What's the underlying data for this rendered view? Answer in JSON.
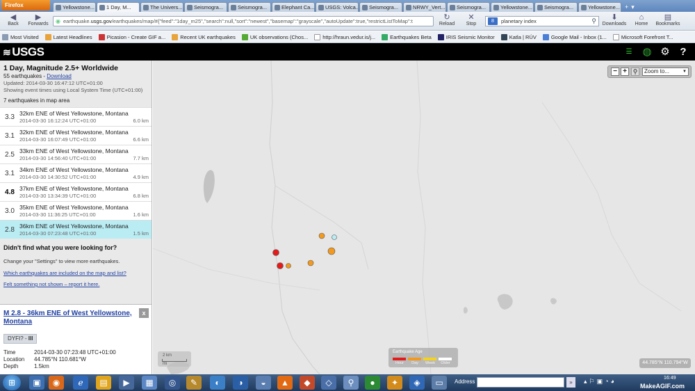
{
  "browser": {
    "app_button": "Firefox",
    "tabs": [
      {
        "label": "Yellowstone...",
        "active": false
      },
      {
        "label": "1 Day, M...",
        "active": true
      },
      {
        "label": "The Univers...",
        "active": false
      },
      {
        "label": "Seismogra...",
        "active": false
      },
      {
        "label": "Seismogra...",
        "active": false
      },
      {
        "label": "Elephant Ca...",
        "active": false
      },
      {
        "label": "USGS: Volca...",
        "active": false
      },
      {
        "label": "Seismogra...",
        "active": false
      },
      {
        "label": "NRWY_Vert...",
        "active": false
      },
      {
        "label": "Seismogra...",
        "active": false
      },
      {
        "label": "Yellowstone...",
        "active": false
      },
      {
        "label": "Seismogra...",
        "active": false
      },
      {
        "label": "Yellowstone...",
        "active": false
      }
    ],
    "nav": {
      "back": "Back",
      "forwards": "Forwards",
      "reload": "Reload",
      "stop": "Stop",
      "downloads": "Downloads",
      "home": "Home",
      "bookmarks": "Bookmarks"
    },
    "url_prefix": "earthquake.",
    "url_domain": "usgs.gov",
    "url_path": "/earthquakes/map/#{\"feed\":\"1day_m25\",\"search\":null,\"sort\":\"newest\",\"basemap\":\"grayscale\",\"autoUpdate\":true,\"restrictListToMap\":t",
    "search_value": "planetary index",
    "bookmarks": [
      "Most Visited",
      "Latest Headlines",
      "Picasion - Create GIF a...",
      "Recent UK earthquakes",
      "UK observations (Chos...",
      "http://hraun.vedur.is/j...",
      "Earthquakes Beta",
      "IRIS Seismic Monitor",
      "Katla | RÚV",
      "Google Mail - Inbox (1...",
      "Microsoft Forefront T..."
    ]
  },
  "usgs": {
    "logo_text": "USGS"
  },
  "sidebar": {
    "title": "1 Day, Magnitude 2.5+ Worldwide",
    "count_text": "55 earthquakes - ",
    "download_link": "Download",
    "updated": "Updated: 2014-03-30 16:47:12 UTC+01:00",
    "time_note": "Showing event times using Local System Time (UTC+01:00)",
    "in_area": "7 earthquakes in map area",
    "earthquakes": [
      {
        "mag": "3.3",
        "place": "32km ENE of West Yellowstone, Montana",
        "time": "2014-03-30 16:12:24 UTC+01:00",
        "depth": "6.0 km",
        "big": false,
        "selected": false
      },
      {
        "mag": "3.1",
        "place": "32km ENE of West Yellowstone, Montana",
        "time": "2014-03-30 16:07:49 UTC+01:00",
        "depth": "6.6 km",
        "big": false,
        "selected": false
      },
      {
        "mag": "2.5",
        "place": "33km ENE of West Yellowstone, Montana",
        "time": "2014-03-30 14:56:40 UTC+01:00",
        "depth": "7.7 km",
        "big": false,
        "selected": false
      },
      {
        "mag": "3.1",
        "place": "34km ENE of West Yellowstone, Montana",
        "time": "2014-03-30 14:30:52 UTC+01:00",
        "depth": "4.9 km",
        "big": false,
        "selected": false
      },
      {
        "mag": "4.8",
        "place": "37km ENE of West Yellowstone, Montana",
        "time": "2014-03-30 13:34:39 UTC+01:00",
        "depth": "6.8 km",
        "big": true,
        "selected": false
      },
      {
        "mag": "3.0",
        "place": "35km ENE of West Yellowstone, Montana",
        "time": "2014-03-30 11:36:25 UTC+01:00",
        "depth": "1.6 km",
        "big": false,
        "selected": false
      },
      {
        "mag": "2.8",
        "place": "36km ENE of West Yellowstone, Montana",
        "time": "2014-03-30 07:23:48 UTC+01:00",
        "depth": "1.5 km",
        "big": false,
        "selected": true
      }
    ],
    "help_title": "Didn't find what you were looking for?",
    "help_settings": "Change your \"Settings\" to view more earthquakes.",
    "help_which": "Which earthquakes are included on the map and list?",
    "help_report": "Felt something not shown – report it here."
  },
  "detail": {
    "title": "M 2.8 - 36km ENE of West Yellowstone, Montana",
    "close": "x",
    "dyfi_label": "DYFI? - ",
    "dyfi_value": "III",
    "time_label": "Time",
    "time_value": "2014-03-30 07:23:48 UTC+01:00",
    "location_label": "Location",
    "location_value": "44.785°N 110.681°W",
    "depth_label": "Depth",
    "depth_value": "1.5km"
  },
  "map": {
    "zoom_label": "Zoom to...",
    "scale_top": "2 km",
    "scale_bottom": "mi",
    "legend_title": "Earthquake Age",
    "legend_items": [
      {
        "label": "Hour",
        "color": "#e31b1b"
      },
      {
        "label": "Day",
        "color": "#f39a1e"
      },
      {
        "label": "Week",
        "color": "#f5d31c"
      },
      {
        "label": "Older",
        "color": "#ffffff"
      }
    ],
    "coords": "44.785°N 110.794°W",
    "markers": [
      {
        "name": "eq-marker-hour-1",
        "color": "#e31b1b"
      },
      {
        "name": "eq-marker-hour-2",
        "color": "#e31b1b"
      },
      {
        "name": "eq-marker-day-1",
        "color": "#f39a1e"
      },
      {
        "name": "eq-marker-day-2",
        "color": "#f39a1e"
      },
      {
        "name": "eq-marker-day-3",
        "color": "#f39a1e"
      },
      {
        "name": "eq-marker-day-4",
        "color": "#f39a1e"
      },
      {
        "name": "eq-marker-selected",
        "color": "#b9ecf3"
      }
    ]
  },
  "taskbar": {
    "address_label": "Address",
    "clock": "16:49",
    "watermark": "MakeAGIF.com"
  }
}
